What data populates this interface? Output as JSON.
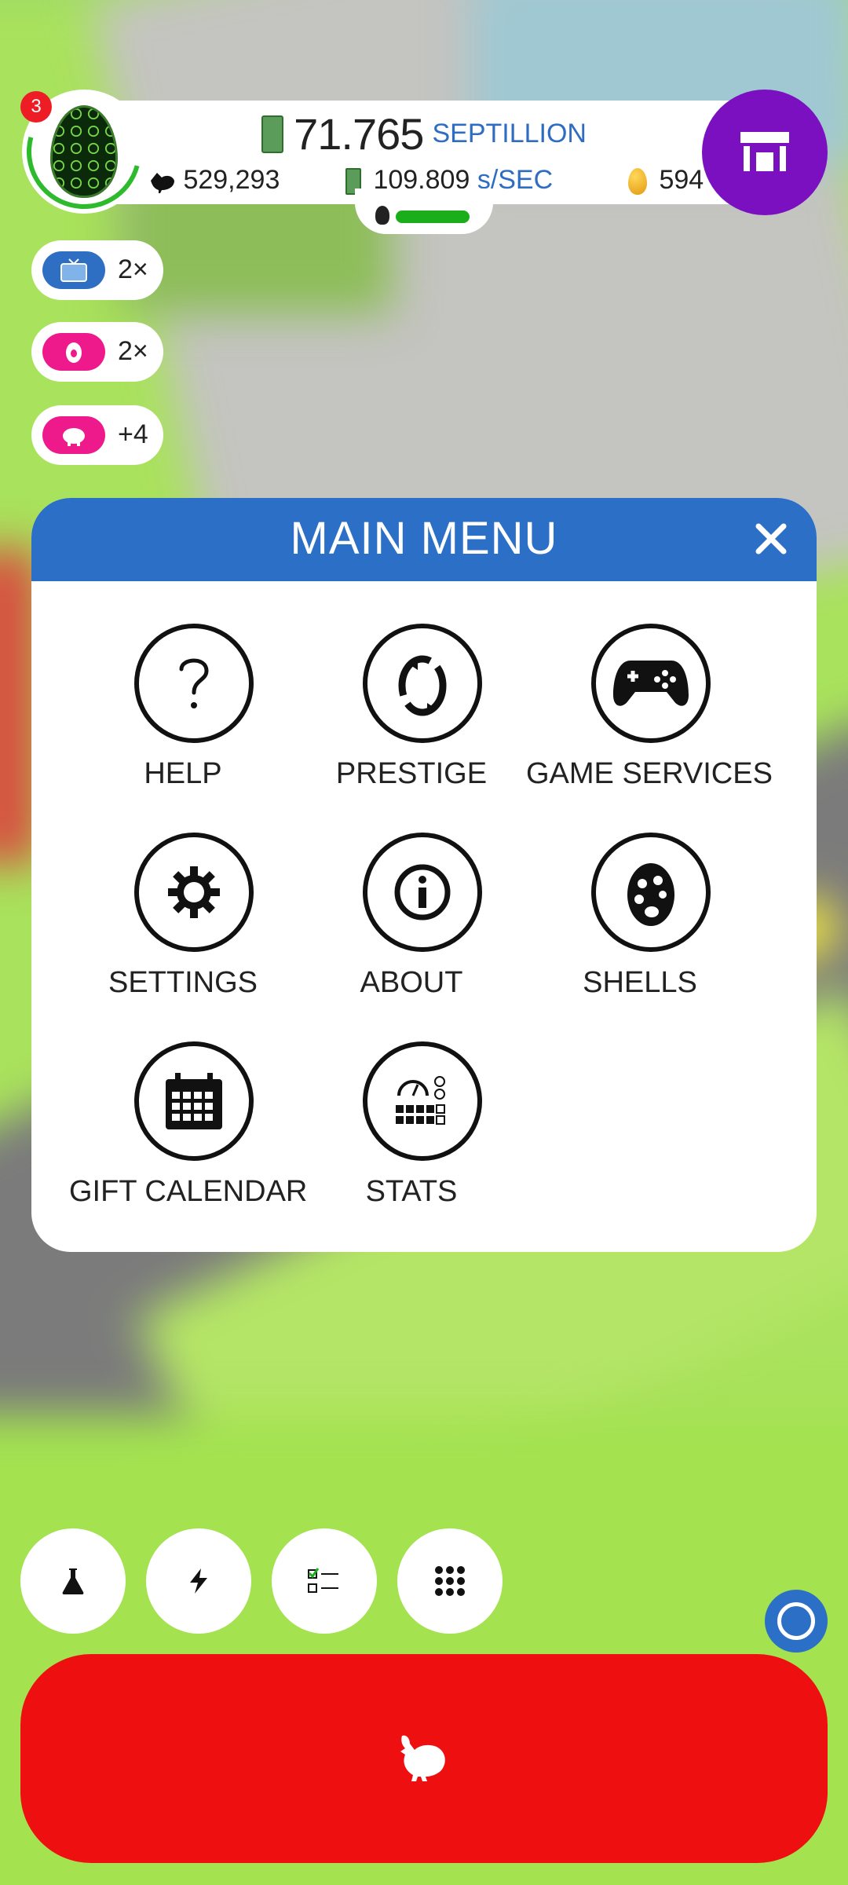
{
  "header": {
    "money_value": "71.765",
    "money_unit": "SEPTILLION",
    "chicken_count": "529,293",
    "earning_value": "109.809",
    "earning_unit": "s/SEC",
    "golden_eggs": "594",
    "notification_count": "3"
  },
  "boosts": [
    {
      "label": "2×",
      "icon": "tv-icon",
      "color": "#2e6fc4"
    },
    {
      "label": "2×",
      "icon": "egg-icon",
      "color": "#ee1a8c"
    },
    {
      "label": "+4",
      "icon": "piggy-bank-icon",
      "color": "#ee1a8c"
    }
  ],
  "menu": {
    "title": "MAIN MENU",
    "items": [
      {
        "label": "HELP",
        "icon": "question-icon"
      },
      {
        "label": "PRESTIGE",
        "icon": "prestige-cycle-icon"
      },
      {
        "label": "GAME SERVICES",
        "icon": "gamepad-icon"
      },
      {
        "label": "SETTINGS",
        "icon": "gear-icon"
      },
      {
        "label": "ABOUT",
        "icon": "info-icon"
      },
      {
        "label": "SHELLS",
        "icon": "palette-egg-icon"
      },
      {
        "label": "GIFT CALENDAR",
        "icon": "calendar-icon"
      },
      {
        "label": "STATS",
        "icon": "stats-icon"
      }
    ]
  },
  "bottom_bar": {
    "buttons": [
      "flask-icon",
      "lightning-icon",
      "checklist-icon",
      "grid-icon"
    ]
  },
  "colors": {
    "menu_header": "#2c6fc6",
    "shop": "#7a10c0",
    "hatch_button": "#ee0f10",
    "accent_blue": "#2f6dc3"
  }
}
